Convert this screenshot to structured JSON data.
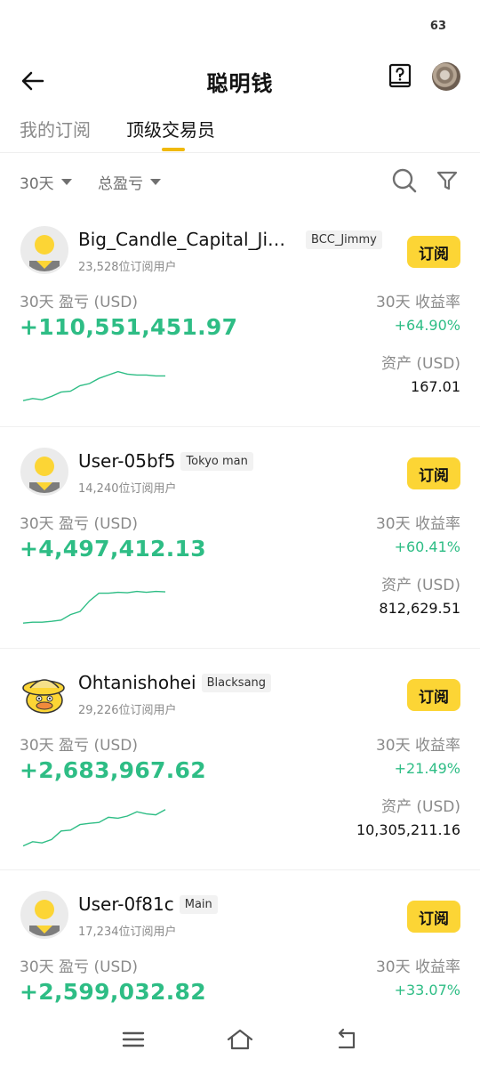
{
  "status": {
    "battery": "63"
  },
  "header": {
    "title": "聪明钱",
    "help_icon": "help-book-icon",
    "back_icon": "back-arrow-icon"
  },
  "tabs": [
    {
      "label": "我的订阅",
      "active": false
    },
    {
      "label": "顶级交易员",
      "active": true
    }
  ],
  "filters": {
    "period": "30天",
    "sort": "总盈亏"
  },
  "accent": "#F0B90B",
  "positive_color": "#2EBD85",
  "traders": [
    {
      "name": "Big_Candle_Capital_Jim...",
      "tag": "BCC_Jimmy",
      "subscribers": "23,528位订阅用户",
      "subscribe": "订阅",
      "pnl_label": "30天 盈亏 (USD)",
      "pnl": "+110,551,451.97",
      "roi_label": "30天 收益率",
      "roi": "+64.90%",
      "asset_label": "资产 (USD)",
      "asset": "167.01",
      "avatar": "default",
      "trend": [
        0.1,
        0.15,
        0.12,
        0.2,
        0.3,
        0.32,
        0.45,
        0.5,
        0.62,
        0.7,
        0.78,
        0.72,
        0.7,
        0.7,
        0.68,
        0.68
      ]
    },
    {
      "name": "User-05bf5",
      "tag": "Tokyo man",
      "subscribers": "14,240位订阅用户",
      "subscribe": "订阅",
      "pnl_label": "30天 盈亏 (USD)",
      "pnl": "+4,497,412.13",
      "roi_label": "30天 收益率",
      "roi": "+60.41%",
      "asset_label": "资产 (USD)",
      "asset": "812,629.51",
      "avatar": "default",
      "trend": [
        0.08,
        0.1,
        0.1,
        0.12,
        0.15,
        0.28,
        0.35,
        0.6,
        0.78,
        0.78,
        0.8,
        0.79,
        0.82,
        0.8,
        0.82,
        0.81
      ]
    },
    {
      "name": "Ohtanishohei",
      "tag": "Blacksang",
      "subscribers": "29,226位订阅用户",
      "subscribe": "订阅",
      "pnl_label": "30天 盈亏 (USD)",
      "pnl": "+2,683,967.62",
      "roi_label": "30天 收益率",
      "roi": "+21.49%",
      "asset_label": "资产 (USD)",
      "asset": "10,305,211.16",
      "avatar": "duck",
      "trend": [
        0.05,
        0.15,
        0.12,
        0.2,
        0.4,
        0.42,
        0.55,
        0.58,
        0.6,
        0.72,
        0.7,
        0.75,
        0.85,
        0.8,
        0.78,
        0.9
      ]
    },
    {
      "name": "User-0f81c",
      "tag": "Main",
      "subscribers": "17,234位订阅用户",
      "subscribe": "订阅",
      "pnl_label": "30天 盈亏 (USD)",
      "pnl": "+2,599,032.82",
      "roi_label": "30天 收益率",
      "roi": "+33.07%",
      "avatar": "default"
    }
  ],
  "navbar": {
    "menu": "menu-icon",
    "home": "home-icon",
    "back": "return-icon"
  }
}
